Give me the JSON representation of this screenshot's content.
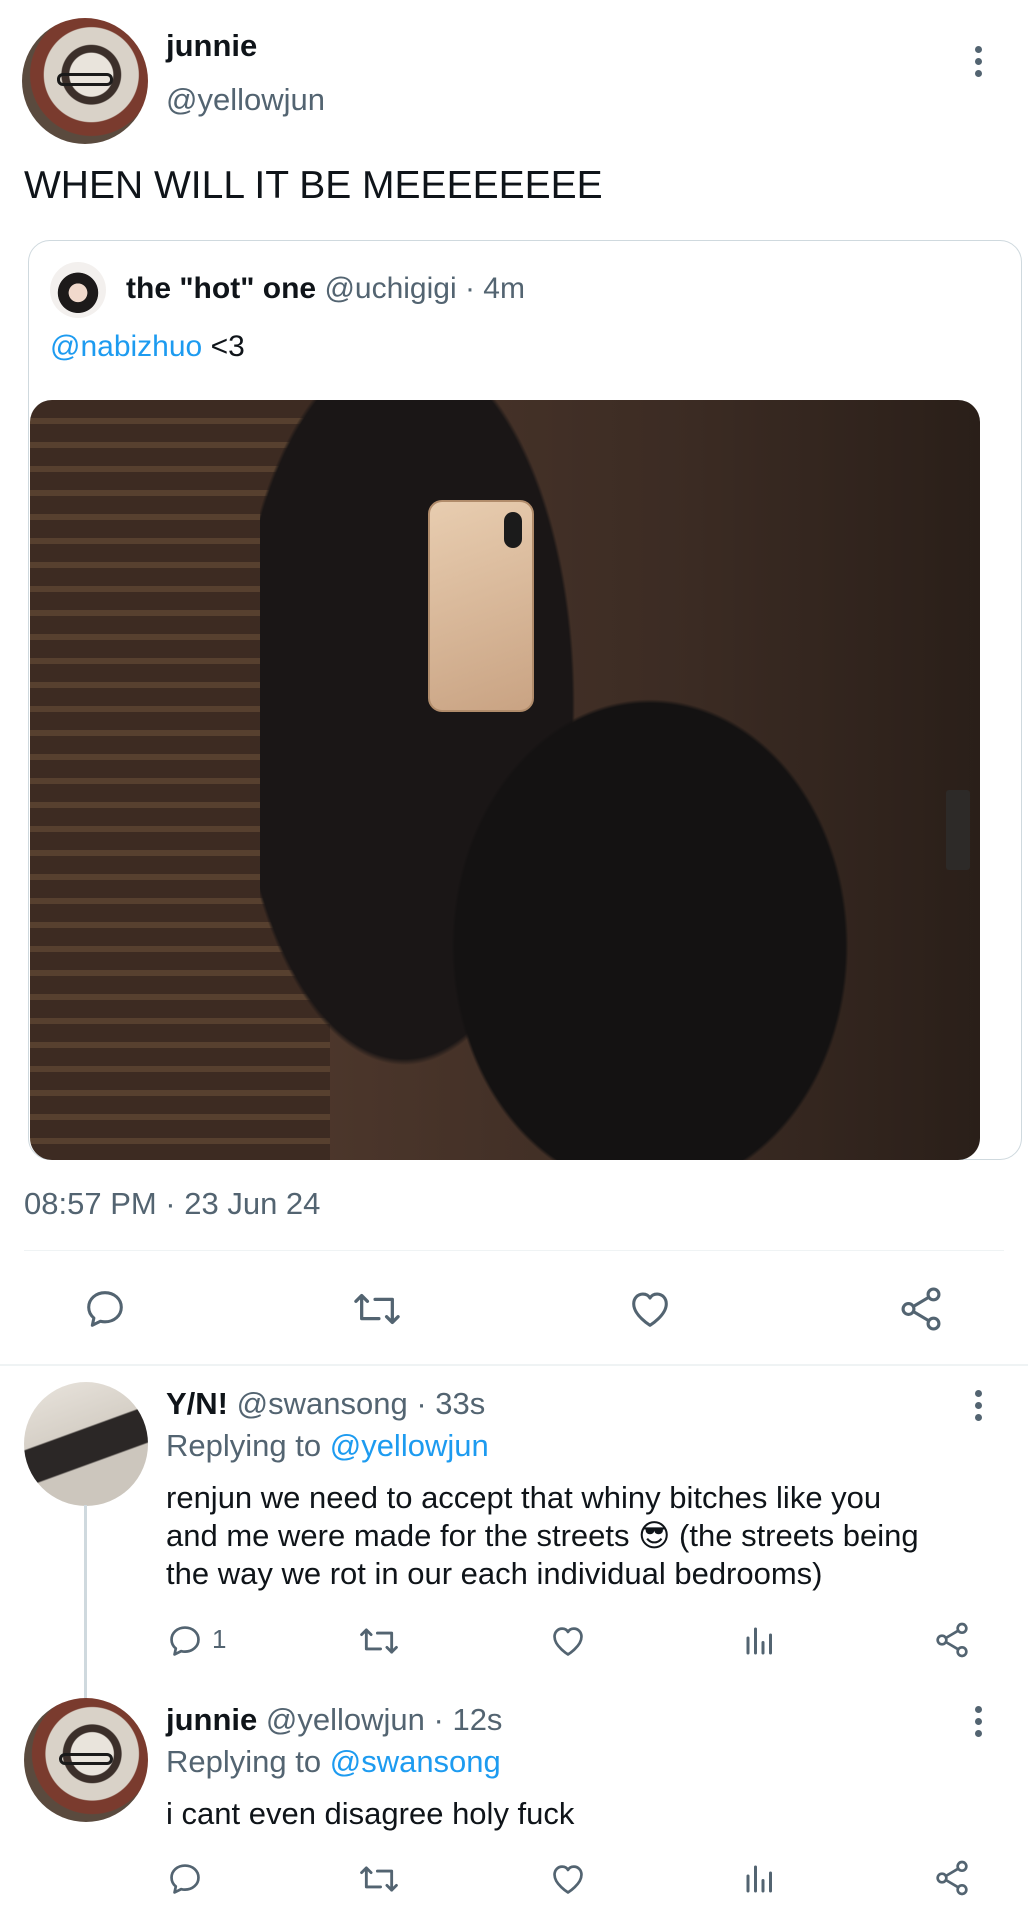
{
  "main_tweet": {
    "author_name": "junnie",
    "author_handle": "@yellowjun",
    "text": "WHEN WILL IT BE MEEEEEEEE",
    "timestamp": "08:57 PM · 23 Jun 24",
    "quoted_tweet": {
      "author_name": "the \"hot\" one",
      "author_handle": "@uchigigi",
      "time_ago": "· 4m",
      "mention": "@nabizhuo",
      "text_after_mention": " <3"
    },
    "actions": [
      "reply",
      "retweet",
      "like",
      "share"
    ]
  },
  "replies": [
    {
      "author_name": "Y/N!",
      "author_handle": "@swansong",
      "time_ago": "· 33s",
      "replying_label": "Replying to ",
      "replying_to": "@yellowjun",
      "text_lines": [
        "renjun we need to accept that whiny bitches like you",
        "and me were made for the streets 😎 (the streets being",
        "the way we rot in our each individual bedrooms)"
      ],
      "reply_count": "1"
    },
    {
      "author_name": "junnie",
      "author_handle": "@yellowjun",
      "time_ago": "· 12s",
      "replying_label": "Replying to ",
      "replying_to": "@swansong",
      "text_lines": [
        "i cant even disagree holy fuck"
      ],
      "reply_count": ""
    }
  ],
  "icons": {
    "more": "more-options-icon",
    "reply": "reply-icon",
    "retweet": "retweet-icon",
    "like": "heart-icon",
    "share": "share-icon",
    "views": "views-icon"
  },
  "colors": {
    "link": "#1d9bf0",
    "muted": "#536471",
    "border": "#cfd9de"
  }
}
